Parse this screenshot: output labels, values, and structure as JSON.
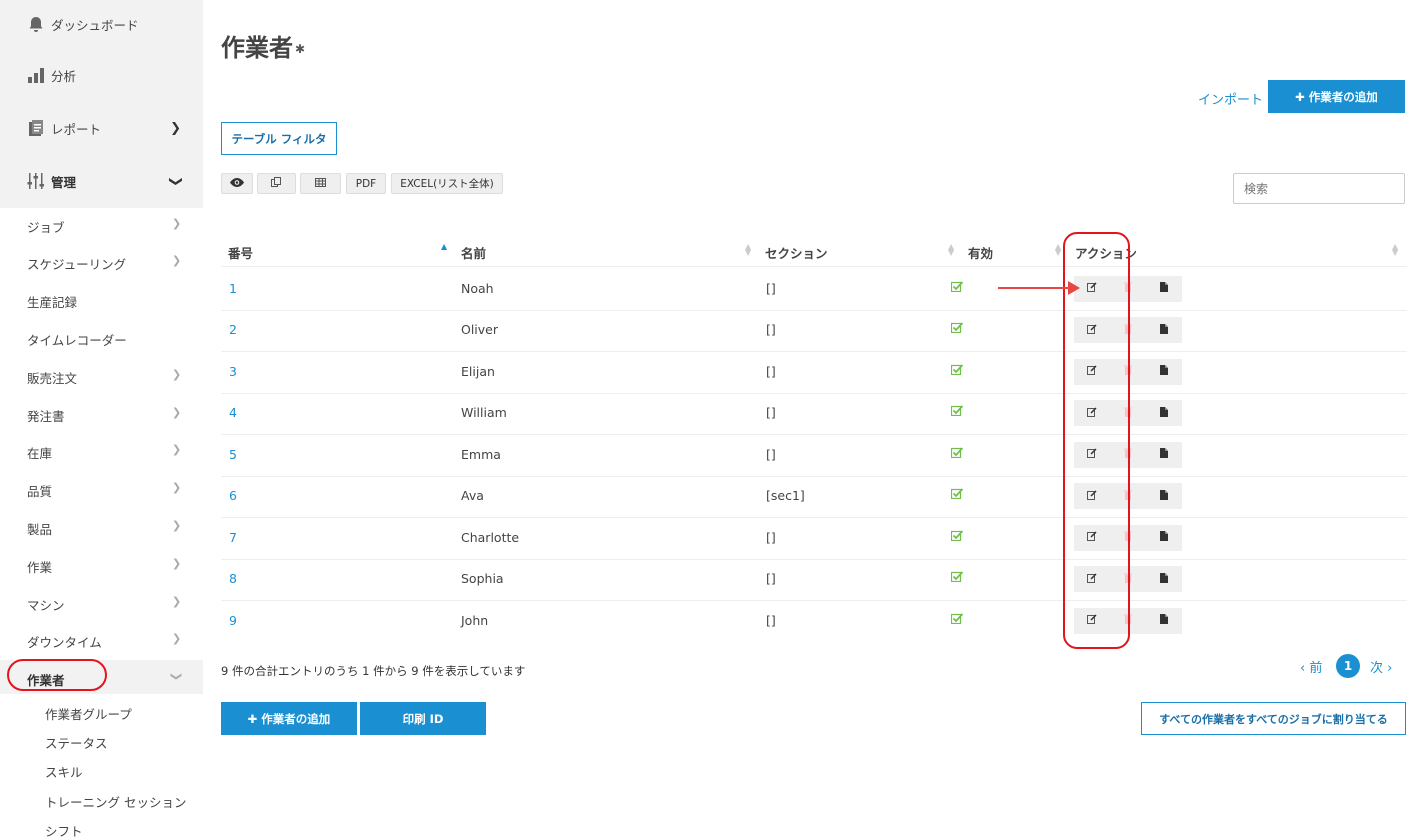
{
  "sidebar": {
    "top_items": [
      {
        "label": "ダッシュボード",
        "icon": "bell-icon"
      },
      {
        "label": "分析",
        "icon": "bar-chart-icon"
      },
      {
        "label": "レポート",
        "icon": "report-icon"
      }
    ],
    "admin": {
      "label": "管理",
      "icon": "sliders-icon"
    },
    "items": [
      {
        "label": "ジョブ",
        "has_arrow": true
      },
      {
        "label": "スケジューリング",
        "has_arrow": true
      },
      {
        "label": "生産記録",
        "has_arrow": false
      },
      {
        "label": "タイムレコーダー",
        "has_arrow": false
      },
      {
        "label": "販売注文",
        "has_arrow": true
      },
      {
        "label": "発注書",
        "has_arrow": true
      },
      {
        "label": "在庫",
        "has_arrow": true
      },
      {
        "label": "品質",
        "has_arrow": true
      },
      {
        "label": "製品",
        "has_arrow": true
      },
      {
        "label": "作業",
        "has_arrow": true
      },
      {
        "label": "マシン",
        "has_arrow": true
      },
      {
        "label": "ダウンタイム",
        "has_arrow": true
      }
    ],
    "active_item": "作業者",
    "sub_items": [
      "作業者グループ",
      "ステータス",
      "スキル",
      "トレーニング セッション",
      "シフト"
    ]
  },
  "page": {
    "title": "作業者",
    "import_label": "インポート",
    "add_worker_label": "✚ 作業者の追加",
    "table_filter_label": "テーブル フィルタ",
    "export_buttons": {
      "pdf": "PDF",
      "excel": "EXCEL(リスト全体)"
    },
    "search_placeholder": "検索"
  },
  "table": {
    "columns": [
      "番号",
      "名前",
      "セクション",
      "有効",
      "アクション"
    ],
    "rows": [
      {
        "id": "1",
        "name": "Noah",
        "section": "[]"
      },
      {
        "id": "2",
        "name": "Oliver",
        "section": "[]"
      },
      {
        "id": "3",
        "name": "Elijan",
        "section": "[]"
      },
      {
        "id": "4",
        "name": "William",
        "section": "[]"
      },
      {
        "id": "5",
        "name": "Emma",
        "section": "[]"
      },
      {
        "id": "6",
        "name": "Ava",
        "section": "[sec1]"
      },
      {
        "id": "7",
        "name": "Charlotte",
        "section": "[]"
      },
      {
        "id": "8",
        "name": "Sophia",
        "section": "[]"
      },
      {
        "id": "9",
        "name": "John",
        "section": "[]"
      }
    ]
  },
  "footer": {
    "info": "9 件の合計エントリのうち 1 件から 9 件を表示しています",
    "prev": "‹ 前",
    "current_page": "1",
    "next": "次 ›",
    "add_worker_label": "✚ 作業者の追加",
    "print_id_label": "印刷 ID",
    "assign_all_label": "すべての作業者をすべてのジョブに割り当てる"
  },
  "colors": {
    "accent": "#1a8fd1",
    "highlight": "#e3141e",
    "check": "#6fbf4a"
  }
}
